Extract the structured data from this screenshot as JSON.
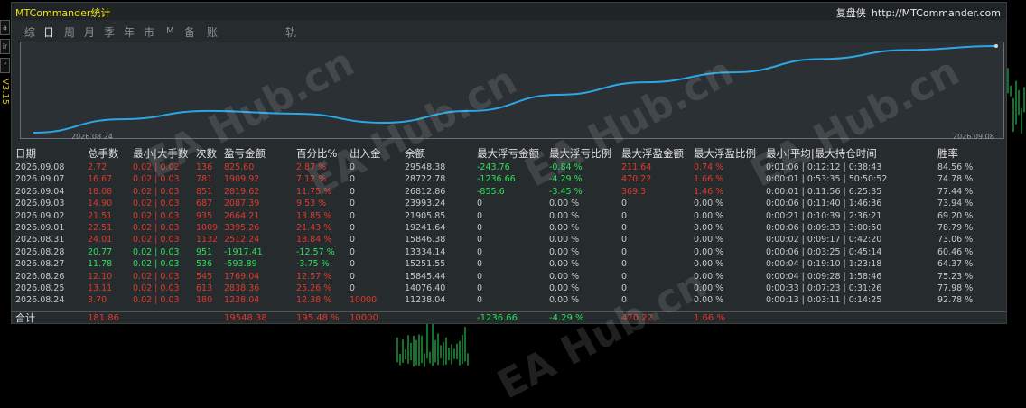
{
  "window": {
    "title": "MTCommander统计",
    "brand": "复盘侠",
    "url": "http://MTCommander.com"
  },
  "left_strip": {
    "labels": [
      "a",
      "ir",
      "f",
      "V3.15"
    ]
  },
  "tabs": [
    {
      "label": "综",
      "active": false
    },
    {
      "label": "日",
      "active": true
    },
    {
      "label": "周",
      "active": false
    },
    {
      "label": "月",
      "active": false
    },
    {
      "label": "季",
      "active": false
    },
    {
      "label": "年",
      "active": false
    },
    {
      "label": "市",
      "active": false
    },
    {
      "label": "M",
      "active": false
    },
    {
      "label": "备",
      "active": false
    },
    {
      "label": "账户",
      "active": false
    },
    {
      "label": "轨迹",
      "active": false
    }
  ],
  "chart": {
    "start_date": "2026.08.24",
    "end_date": "2026.09.08",
    "line_color": "#2aa7e6",
    "equity_series": [
      11238.04,
      14076.4,
      15845.44,
      15251.55,
      13334.14,
      15846.38,
      19241.64,
      21905.85,
      23993.24,
      26812.86,
      28722.78,
      29548.38
    ]
  },
  "table": {
    "headers": [
      "日期",
      "总手数",
      "最小|大手数",
      "次数",
      "盈亏金额",
      "百分比%",
      "出入金",
      "余额",
      "最大浮亏金额",
      "最大浮亏比例",
      "最大浮盈金额",
      "最大浮盈比例",
      "最小|平均|最大持仓时间",
      "胜率"
    ],
    "rows": [
      {
        "date": "2026.09.08",
        "lots": "2.72",
        "minmax": "0.02 | 0.02",
        "count": "136",
        "pnl": "825.60",
        "pct": "2.87 %",
        "flow": "0",
        "balance": "29548.38",
        "maxdd": "-243.76",
        "maxdd_pct": "-0.84 %",
        "maxfp": "211.64",
        "maxfp_pct": "0.74 %",
        "hold": "0:01:06 | 0:12:12 | 0:38:43",
        "win": "84.56 %",
        "tone": "red"
      },
      {
        "date": "2026.09.07",
        "lots": "16.67",
        "minmax": "0.02 | 0.03",
        "count": "781",
        "pnl": "1909.92",
        "pct": "7.12 %",
        "flow": "0",
        "balance": "28722.78",
        "maxdd": "-1236.66",
        "maxdd_pct": "-4.29 %",
        "maxfp": "470.22",
        "maxfp_pct": "1.66 %",
        "hold": "0:00:01 | 0:53:35 | 50:50:52",
        "win": "74.78 %",
        "tone": "red"
      },
      {
        "date": "2026.09.04",
        "lots": "18.08",
        "minmax": "0.02 | 0.03",
        "count": "851",
        "pnl": "2819.62",
        "pct": "11.75 %",
        "flow": "0",
        "balance": "26812.86",
        "maxdd": "-855.6",
        "maxdd_pct": "-3.45 %",
        "maxfp": "369.3",
        "maxfp_pct": "1.46 %",
        "hold": "0:00:01 | 0:11:56 | 6:25:35",
        "win": "77.44 %",
        "tone": "red"
      },
      {
        "date": "2026.09.03",
        "lots": "14.90",
        "minmax": "0.02 | 0.03",
        "count": "687",
        "pnl": "2087.39",
        "pct": "9.53 %",
        "flow": "0",
        "balance": "23993.24",
        "maxdd": "0",
        "maxdd_pct": "0.00 %",
        "maxfp": "0",
        "maxfp_pct": "0.00 %",
        "hold": "0:00:06 | 0:11:40 | 1:46:36",
        "win": "73.94 %",
        "tone": "red"
      },
      {
        "date": "2026.09.02",
        "lots": "21.51",
        "minmax": "0.02 | 0.03",
        "count": "935",
        "pnl": "2664.21",
        "pct": "13.85 %",
        "flow": "0",
        "balance": "21905.85",
        "maxdd": "0",
        "maxdd_pct": "0.00 %",
        "maxfp": "0",
        "maxfp_pct": "0.00 %",
        "hold": "0:00:21 | 0:10:39 | 2:36:21",
        "win": "69.20 %",
        "tone": "red"
      },
      {
        "date": "2026.09.01",
        "lots": "22.51",
        "minmax": "0.02 | 0.03",
        "count": "1009",
        "pnl": "3395.26",
        "pct": "21.43 %",
        "flow": "0",
        "balance": "19241.64",
        "maxdd": "0",
        "maxdd_pct": "0.00 %",
        "maxfp": "0",
        "maxfp_pct": "0.00 %",
        "hold": "0:00:06 | 0:09:33 | 3:00:50",
        "win": "78.79 %",
        "tone": "red"
      },
      {
        "date": "2026.08.31",
        "lots": "24.01",
        "minmax": "0.02 | 0.03",
        "count": "1132",
        "pnl": "2512.24",
        "pct": "18.84 %",
        "flow": "0",
        "balance": "15846.38",
        "maxdd": "0",
        "maxdd_pct": "0.00 %",
        "maxfp": "0",
        "maxfp_pct": "0.00 %",
        "hold": "0:00:02 | 0:09:17 | 0:42:20",
        "win": "73.06 %",
        "tone": "red"
      },
      {
        "date": "2026.08.28",
        "lots": "20.77",
        "minmax": "0.02 | 0.03",
        "count": "951",
        "pnl": "-1917.41",
        "pct": "-12.57 %",
        "flow": "0",
        "balance": "13334.14",
        "maxdd": "0",
        "maxdd_pct": "0.00 %",
        "maxfp": "0",
        "maxfp_pct": "0.00 %",
        "hold": "0:00:06 | 0:03:25 | 0:45:14",
        "win": "60.46 %",
        "tone": "green"
      },
      {
        "date": "2026.08.27",
        "lots": "11.78",
        "minmax": "0.02 | 0.03",
        "count": "536",
        "pnl": "-593.89",
        "pct": "-3.75 %",
        "flow": "0",
        "balance": "15251.55",
        "maxdd": "0",
        "maxdd_pct": "0.00 %",
        "maxfp": "0",
        "maxfp_pct": "0.00 %",
        "hold": "0:00:04 | 0:19:10 | 1:23:18",
        "win": "64.37 %",
        "tone": "green"
      },
      {
        "date": "2026.08.26",
        "lots": "12.10",
        "minmax": "0.02 | 0.03",
        "count": "545",
        "pnl": "1769.04",
        "pct": "12.57 %",
        "flow": "0",
        "balance": "15845.44",
        "maxdd": "0",
        "maxdd_pct": "0.00 %",
        "maxfp": "0",
        "maxfp_pct": "0.00 %",
        "hold": "0:00:04 | 0:09:28 | 1:58:46",
        "win": "75.23 %",
        "tone": "red"
      },
      {
        "date": "2026.08.25",
        "lots": "13.11",
        "minmax": "0.02 | 0.03",
        "count": "613",
        "pnl": "2838.36",
        "pct": "25.26 %",
        "flow": "0",
        "balance": "14076.40",
        "maxdd": "0",
        "maxdd_pct": "0.00 %",
        "maxfp": "0",
        "maxfp_pct": "0.00 %",
        "hold": "0:00:33 | 0:07:23 | 0:31:26",
        "win": "77.98 %",
        "tone": "red"
      },
      {
        "date": "2026.08.24",
        "lots": "3.70",
        "minmax": "0.02 | 0.03",
        "count": "180",
        "pnl": "1238.04",
        "pct": "12.38 %",
        "flow": "10000",
        "balance": "11238.04",
        "maxdd": "0",
        "maxdd_pct": "0.00 %",
        "maxfp": "0",
        "maxfp_pct": "0.00 %",
        "hold": "0:00:13 | 0:03:11 | 0:14:25",
        "win": "92.78 %",
        "tone": "red"
      }
    ],
    "total": {
      "label": "合计",
      "lots": "181.86",
      "pnl": "19548.38",
      "pct": "195.48 %",
      "flow": "10000",
      "maxdd": "-1236.66",
      "maxdd_pct": "-4.29 %",
      "maxfp": "470.22",
      "maxfp_pct": "1.66 %"
    }
  },
  "watermark": "EA Hub.cn",
  "colors": {
    "positive": "#e0392b",
    "negative": "#2de05a",
    "title": "#f0e020",
    "equity_line": "#2aa7e6"
  }
}
